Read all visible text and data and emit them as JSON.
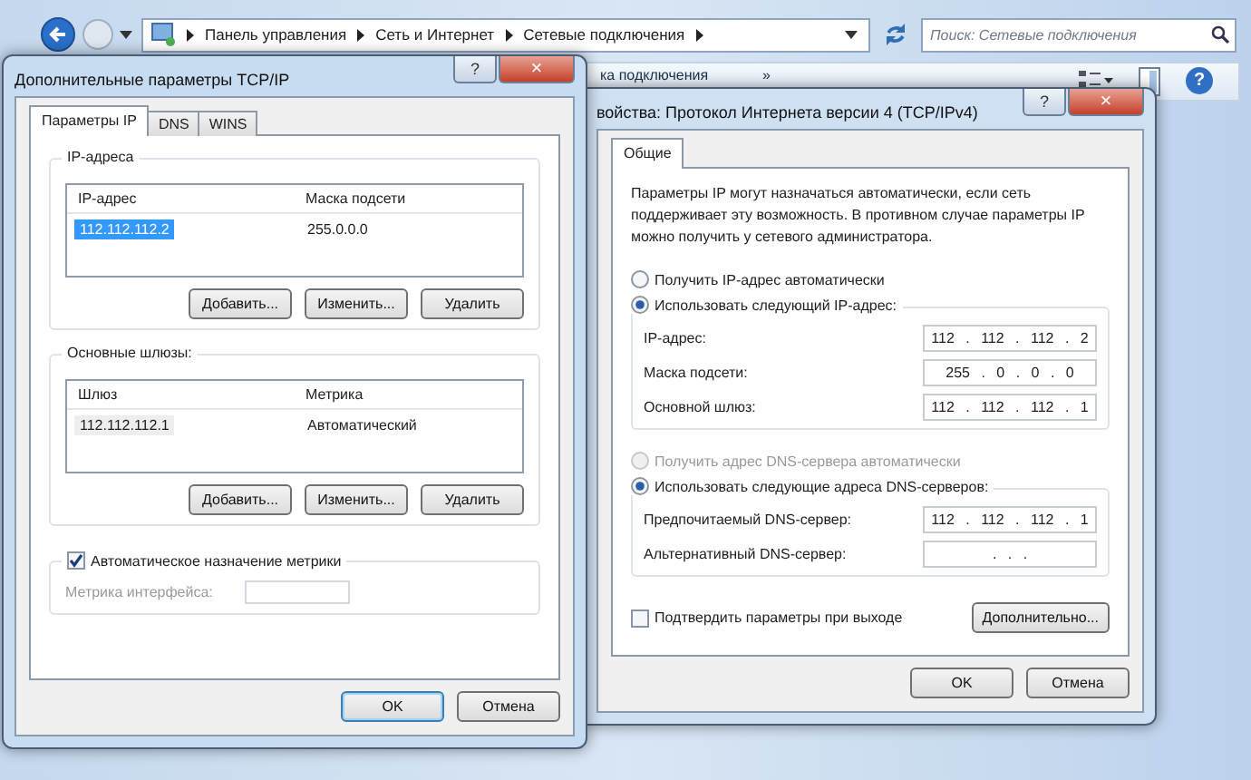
{
  "explorer": {
    "address_path": [
      "Панель управления",
      "Сеть и Интернет",
      "Сетевые подключения"
    ],
    "search": {
      "placeholder": "Поиск: Сетевые подключения"
    },
    "toolbar_items": [
      "ка подключения",
      "»"
    ],
    "help_button": "?"
  },
  "advanced_dialog": {
    "title": "Дополнительные параметры TCP/IP",
    "title_buttons": [
      "?",
      "×"
    ],
    "tabs": [
      {
        "label": "Параметры IP",
        "selected": true
      },
      {
        "label": "DNS",
        "selected": false
      },
      {
        "label": "WINS",
        "selected": false
      }
    ],
    "ip_addresses": {
      "title": "IP-адреса",
      "columns": [
        "IP-адрес",
        "Маска подсети"
      ],
      "rows": [
        {
          "cells": [
            "112.112.112.2",
            "255.0.0.0"
          ],
          "selected": true
        }
      ],
      "buttons": [
        "Добавить...",
        "Изменить...",
        "Удалить"
      ]
    },
    "gateways": {
      "title": "Основные шлюзы:",
      "columns": [
        "Шлюз",
        "Метрика"
      ],
      "rows": [
        {
          "cells": [
            "112.112.112.1",
            "Автоматический"
          ],
          "selected": false
        }
      ],
      "buttons": [
        "Добавить...",
        "Изменить...",
        "Удалить"
      ]
    },
    "auto_metric": {
      "label": "Автоматическое назначение метрики",
      "checked": true
    },
    "interface_metric": {
      "label": "Метрика интерфейса:",
      "disabled": true
    },
    "buttons": [
      {
        "label": "OK",
        "default": true
      },
      {
        "label": "Отмена",
        "default": false
      }
    ]
  },
  "ipv4_dialog": {
    "title": "войства: Протокол Интернета версии 4 (TCP/IPv4)",
    "title_buttons": [
      "?",
      "×"
    ],
    "tabs": [
      {
        "label": "Общие",
        "selected": true
      }
    ],
    "description": "Параметры IP могут назначаться автоматически, если сеть поддерживает эту возможность. В противном случае параметры IP можно получить у сетевого администратора.",
    "ip_mode": [
      {
        "label": "Получить IP-адрес автоматически",
        "selected": false,
        "disabled": false
      },
      {
        "label": "Использовать следующий IP-адрес:",
        "selected": true,
        "disabled": false
      }
    ],
    "ip_fields": [
      {
        "label": "IP-адрес:",
        "value": "112 . 112 . 112 . 2"
      },
      {
        "label": "Маска подсети:",
        "value": "255 . 0 . 0 . 0"
      },
      {
        "label": "Основной шлюз:",
        "value": "112 . 112 . 112 . 1"
      }
    ],
    "dns_mode": [
      {
        "label": "Получить адрес DNS-сервера автоматически",
        "selected": false,
        "disabled": true
      },
      {
        "label": "Использовать следующие адреса DNS-серверов:",
        "selected": true,
        "disabled": false
      }
    ],
    "dns_fields": [
      {
        "label": "Предпочитаемый DNS-сервер:",
        "value": "112 . 112 . 112 . 1"
      },
      {
        "label": "Альтернативный DNS-сервер:",
        "value": ". . ."
      }
    ],
    "validate_on_exit": {
      "label": "Подтвердить параметры при выходе",
      "checked": false
    },
    "advanced_button": "Дополнительно...",
    "buttons": [
      {
        "label": "OK",
        "default": false
      },
      {
        "label": "Отмена",
        "default": false
      }
    ]
  }
}
